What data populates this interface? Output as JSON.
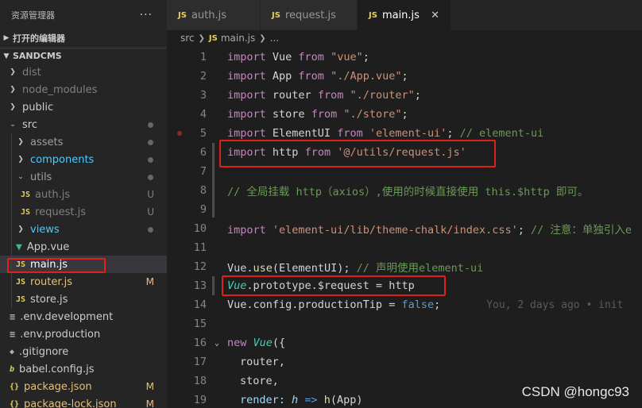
{
  "sidebar": {
    "title": "资源管理器",
    "more": "···",
    "open_editors": "打开的编辑器",
    "project": "SANDCMS",
    "items": [
      {
        "label": "dist",
        "icon": "chevron-right",
        "badge": ""
      },
      {
        "label": "node_modules",
        "icon": "chevron-right",
        "badge": ""
      },
      {
        "label": "public",
        "icon": "chevron-right",
        "badge": ""
      },
      {
        "label": "src",
        "icon": "chevron-down",
        "badge": ""
      },
      {
        "label": "assets",
        "icon": "chevron-right",
        "badge": ""
      },
      {
        "label": "components",
        "icon": "chevron-right",
        "badge": ""
      },
      {
        "label": "utils",
        "icon": "chevron-down",
        "badge": ""
      },
      {
        "label": "auth.js",
        "icon": "js-file",
        "badge": "U"
      },
      {
        "label": "request.js",
        "icon": "js-file",
        "badge": "U"
      },
      {
        "label": "views",
        "icon": "chevron-right",
        "badge": ""
      },
      {
        "label": "App.vue",
        "icon": "vue-file",
        "badge": ""
      },
      {
        "label": "main.js",
        "icon": "js-file",
        "badge": ""
      },
      {
        "label": "router.js",
        "icon": "js-file",
        "badge": "M"
      },
      {
        "label": "store.js",
        "icon": "js-file",
        "badge": ""
      },
      {
        "label": ".env.development",
        "icon": "env-file",
        "badge": ""
      },
      {
        "label": ".env.production",
        "icon": "env-file",
        "badge": ""
      },
      {
        "label": ".gitignore",
        "icon": "git-file",
        "badge": ""
      },
      {
        "label": "babel.config.js",
        "icon": "babel-file",
        "badge": ""
      },
      {
        "label": "package.json",
        "icon": "json-file",
        "badge": "M"
      },
      {
        "label": "package-lock.json",
        "icon": "json-file",
        "badge": "M"
      }
    ]
  },
  "tabs": [
    {
      "label": "auth.js",
      "icon": "js-file"
    },
    {
      "label": "request.js",
      "icon": "js-file"
    },
    {
      "label": "main.js",
      "icon": "js-file",
      "active": true
    }
  ],
  "breadcrumb": {
    "folder": "src",
    "file": "main.js",
    "more": "..."
  },
  "code_lines": [
    {
      "n": "1"
    },
    {
      "n": "2"
    },
    {
      "n": "3"
    },
    {
      "n": "4"
    },
    {
      "n": "5"
    },
    {
      "n": "6"
    },
    {
      "n": "7"
    },
    {
      "n": "8"
    },
    {
      "n": "9"
    },
    {
      "n": "10"
    },
    {
      "n": "11"
    },
    {
      "n": "12"
    },
    {
      "n": "13"
    },
    {
      "n": "14"
    },
    {
      "n": "15"
    },
    {
      "n": "16"
    },
    {
      "n": "17"
    },
    {
      "n": "18"
    },
    {
      "n": "19"
    }
  ],
  "code": {
    "l1": [
      "import",
      " Vue ",
      "from",
      " \"vue\"",
      ";"
    ],
    "l2": [
      "import",
      " App ",
      "from",
      " \"./App.vue\"",
      ";"
    ],
    "l3": [
      "import",
      " router ",
      "from",
      " \"./router\"",
      ";"
    ],
    "l4": [
      "import",
      " store ",
      "from",
      " \"./store\"",
      ";"
    ],
    "l5": [
      "import",
      " ElementUI ",
      "from",
      " 'element-ui'",
      "; ",
      "// element-ui"
    ],
    "l6": [
      "import",
      " http ",
      "from",
      " '@/utils/request.js'"
    ],
    "l8": "// 全局挂载 http（axios）,使用的时候直接使用 this.$http 即可。",
    "l10": [
      "import",
      " 'element-ui/lib/theme-chalk/index.css'",
      "; ",
      "// 注意：单独引入e"
    ],
    "l12": [
      "Vue",
      ".",
      "use",
      "(ElementUI); ",
      "// 声明使用element-ui"
    ],
    "l13": [
      "Vue",
      ".prototype.$request = http"
    ],
    "l14": [
      "Vue.config.productionTip = ",
      "false",
      ";"
    ],
    "l14_blame": "You, 2 days ago • init",
    "l16": [
      "new",
      " ",
      "Vue",
      "({"
    ],
    "l17": "router,",
    "l18": "store,",
    "l19": [
      "render: ",
      "h",
      " => ",
      "h",
      "(App)"
    ]
  },
  "watermark": "CSDN @hongc93",
  "colors": {
    "highlight_box": "#e0201b",
    "keyword": "#c586c0",
    "string": "#ce9178",
    "comment": "#6a9955"
  }
}
